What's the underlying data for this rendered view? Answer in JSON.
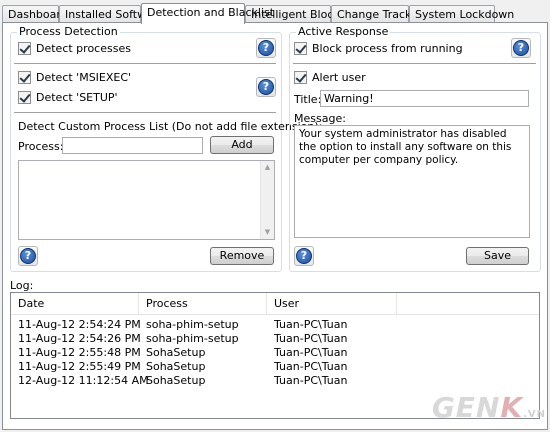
{
  "tabs": [
    {
      "label": "Dashboard"
    },
    {
      "label": "Installed Software"
    },
    {
      "label": "Detection and Blacklist"
    },
    {
      "label": "Intelligent Blocking"
    },
    {
      "label": "Change Tracking"
    },
    {
      "label": "System Lockdown"
    }
  ],
  "active_tab": "Detection and Blacklist",
  "process_detection": {
    "title": "Process Detection",
    "detect_processes": {
      "label": "Detect processes",
      "checked": true
    },
    "detect_msiexec": {
      "label": "Detect 'MSIEXEC'",
      "checked": true
    },
    "detect_setup": {
      "label": "Detect 'SETUP'",
      "checked": true
    },
    "custom_list_label": "Detect Custom Process List (Do not add file extension):",
    "process_label": "Process:",
    "process_value": "",
    "add_label": "Add",
    "remove_label": "Remove"
  },
  "active_response": {
    "title": "Active Response",
    "block_process": {
      "label": "Block process from running",
      "checked": true
    },
    "alert_user": {
      "label": "Alert user",
      "checked": true
    },
    "title_label": "Title:",
    "title_value": "Warning!",
    "message_label": "Message:",
    "message_value": "Your system administrator has disabled the option to install any software on this computer per company policy.",
    "save_label": "Save"
  },
  "log": {
    "label": "Log:",
    "columns": [
      "Date",
      "Process",
      "User"
    ],
    "rows": [
      [
        "11-Aug-12 2:54:24 PM",
        "soha-phim-setup",
        "Tuan-PC\\Tuan"
      ],
      [
        "11-Aug-12 2:54:26 PM",
        "soha-phim-setup",
        "Tuan-PC\\Tuan"
      ],
      [
        "11-Aug-12 2:55:48 PM",
        "SohaSetup",
        "Tuan-PC\\Tuan"
      ],
      [
        "11-Aug-12 2:55:49 PM",
        "SohaSetup",
        "Tuan-PC\\Tuan"
      ],
      [
        "12-Aug-12 11:12:54 AM",
        "SohaSetup",
        "Tuan-PC\\Tuan"
      ]
    ]
  },
  "watermark": {
    "text_a": "GEN",
    "text_b": "K",
    "text_c": ".VN"
  },
  "icons": {
    "help": "help-icon",
    "check": "check-icon"
  },
  "colors": {
    "help_blue": "#1c4fa0"
  }
}
